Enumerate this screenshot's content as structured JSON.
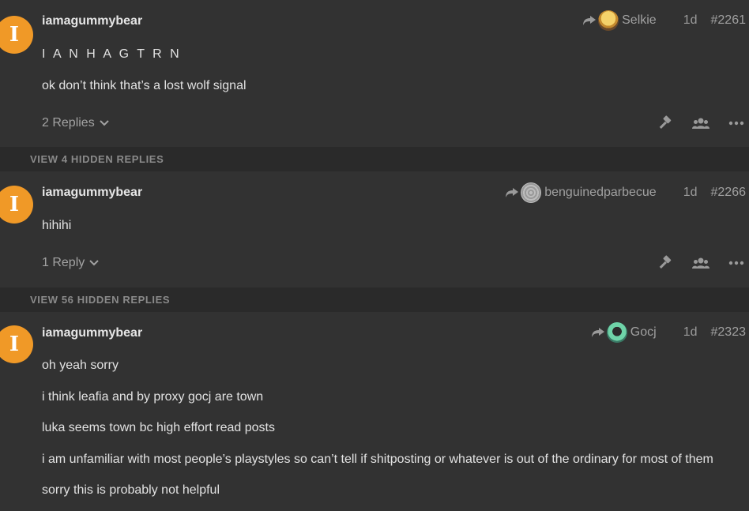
{
  "posts": [
    {
      "avatar_letter": "I",
      "username": "iamagummybear",
      "reply_to": "Selkie",
      "age": "1d",
      "post_number": "#2261",
      "lines": [
        "I A N H A G T R N",
        "ok don’t think that’s a lost wolf signal"
      ],
      "replies_label": "2 Replies"
    },
    {
      "avatar_letter": "I",
      "username": "iamagummybear",
      "reply_to": "benguinedparbecue",
      "age": "1d",
      "post_number": "#2266",
      "lines": [
        "hihihi"
      ],
      "replies_label": "1 Reply"
    },
    {
      "avatar_letter": "I",
      "username": "iamagummybear",
      "reply_to": "Gocj",
      "age": "1d",
      "post_number": "#2323",
      "lines": [
        "oh yeah sorry",
        "i think leafia and by proxy gocj are town",
        "luka seems town bc high effort read posts",
        "i am unfamiliar with most people’s playstyles so can’t tell if shitposting or whatever is out of the ordinary for most of them",
        "sorry this is probably not helpful"
      ]
    }
  ],
  "hidden_bars": [
    "VIEW 4 HIDDEN REPLIES",
    "VIEW 56 HIDDEN REPLIES"
  ],
  "icons": {
    "reply_arrow": "reply-arrow-icon",
    "chevron": "chevron-down-icon",
    "admin": "hammer-icon",
    "group": "users-icon",
    "more": "ellipsis-icon"
  },
  "colors": {
    "avatar": "#f09927",
    "background": "#323232",
    "bar": "#2a2a2a"
  }
}
